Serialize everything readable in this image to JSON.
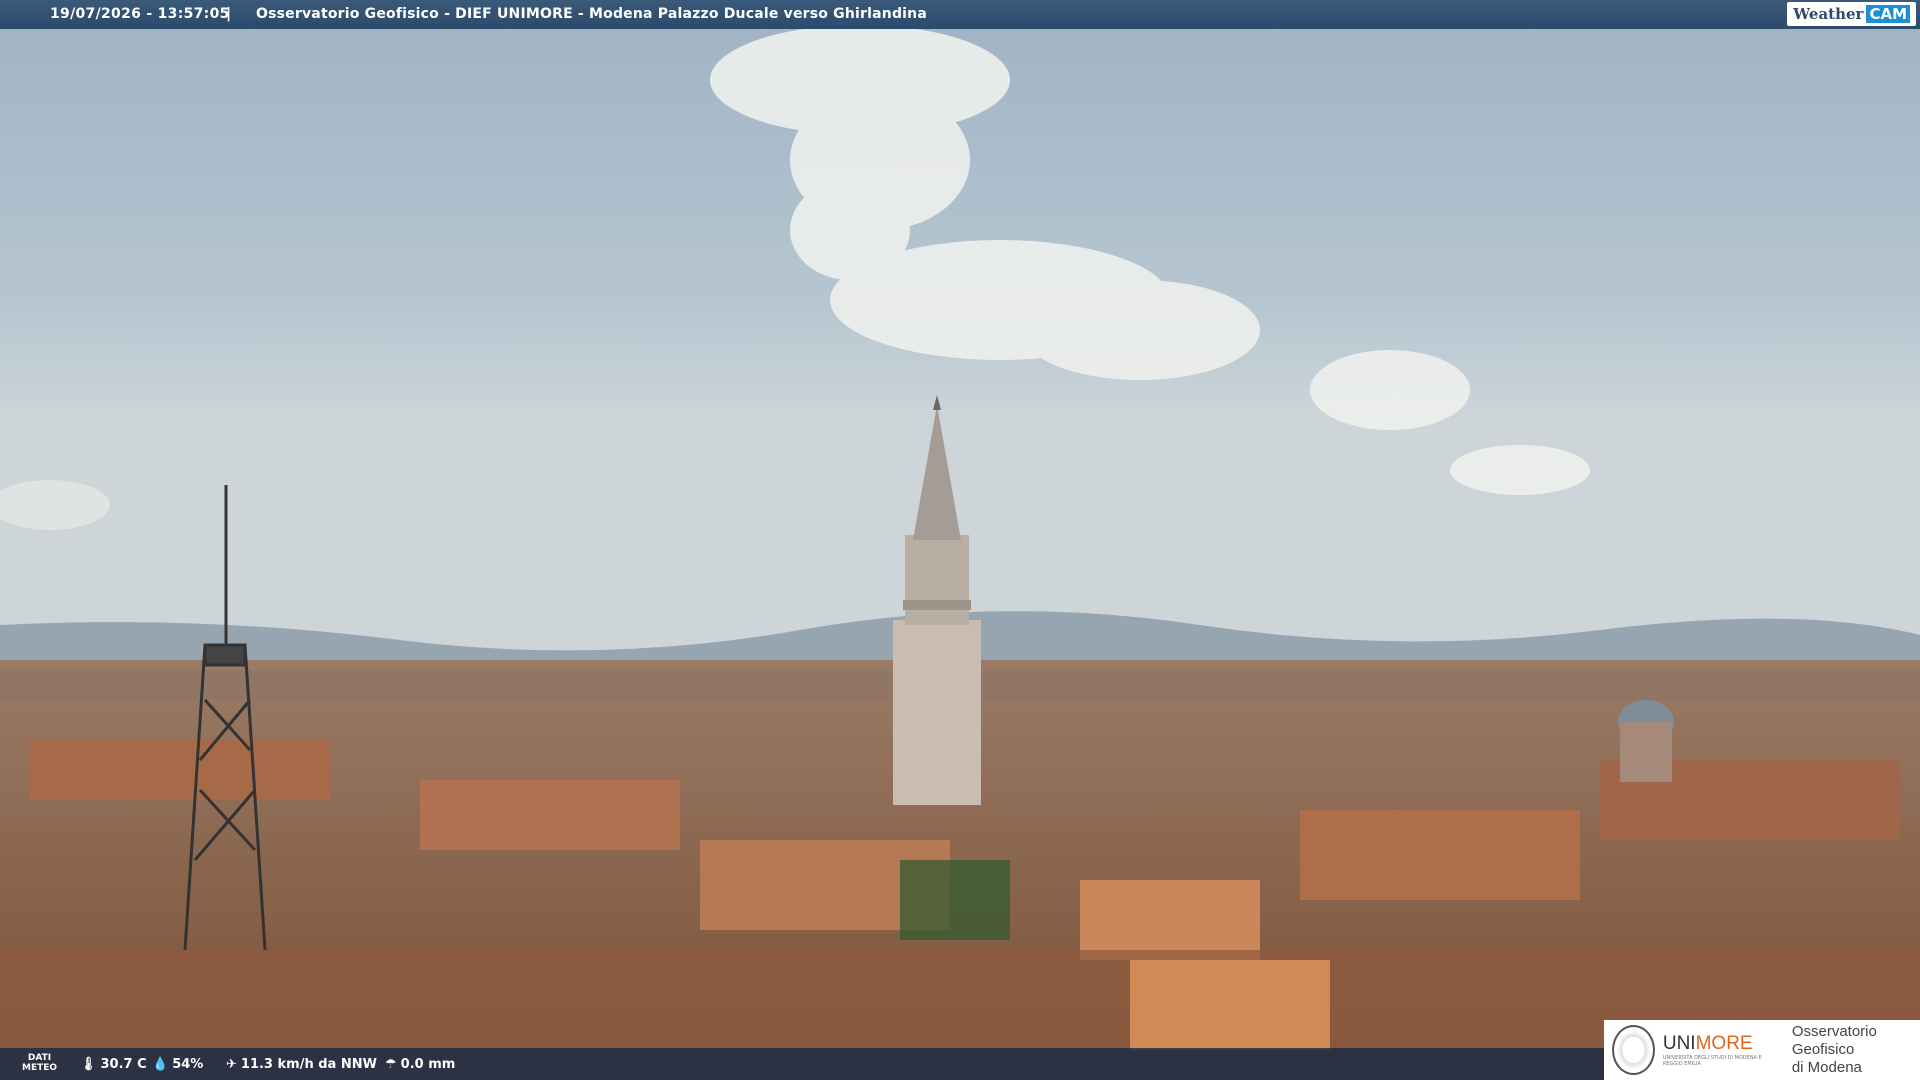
{
  "header": {
    "timestamp": "19/07/2026 - 13:57:05",
    "separator": "|",
    "title": "Osservatorio Geofisico - DIEF UNIMORE - Modena Palazzo Ducale verso Ghirlandina",
    "logo_weather": "Weather",
    "logo_cam": "CAM"
  },
  "weather": {
    "label_line1": "DATI",
    "label_line2": "METEO",
    "temperature": "30.7 C",
    "humidity": "54%",
    "wind": "11.3 km/h da NNW",
    "rain": "0.0 mm"
  },
  "footer_logo": {
    "brand_prefix": "UNI",
    "brand_suffix": "MORE",
    "brand_sub": "UNIVERSITÀ DEGLI STUDI DI MODENA E REGGIO EMILIA",
    "observatory_line1": "Osservatorio Geofisico",
    "observatory_line2": "di Modena"
  },
  "colors": {
    "bar": "#2c4a6b",
    "accent": "#e3641c",
    "sky": "#a9bccb"
  }
}
